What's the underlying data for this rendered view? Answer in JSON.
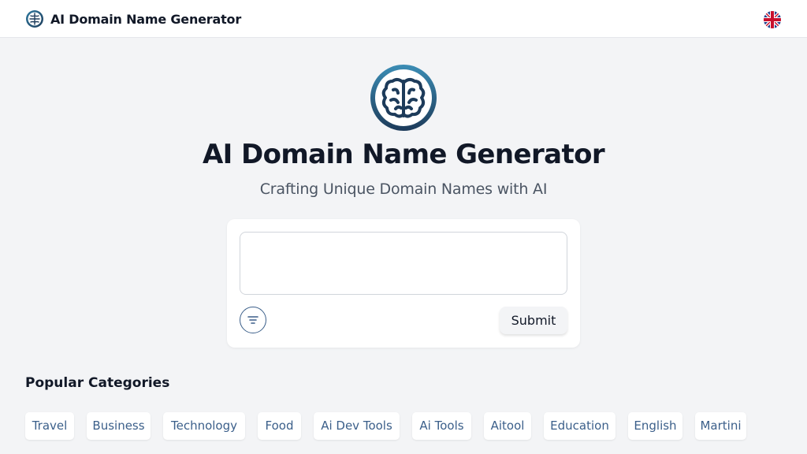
{
  "header": {
    "title": "AI Domain Name Generator",
    "logo_icon": "brain-globe-icon",
    "language_icon": "uk-flag-icon"
  },
  "hero": {
    "logo_icon": "brain-icon",
    "title": "AI Domain Name Generator",
    "subtitle": "Crafting Unique Domain Names with AI"
  },
  "form": {
    "input_value": "",
    "input_placeholder": "",
    "filter_icon": "filter-lines-icon",
    "submit_label": "Submit"
  },
  "categories": {
    "title": "Popular Categories",
    "items": [
      {
        "label": "Travel"
      },
      {
        "label": "Business"
      },
      {
        "label": "Technology"
      },
      {
        "label": "Food"
      },
      {
        "label": "Ai Dev Tools"
      },
      {
        "label": "Ai Tools"
      },
      {
        "label": "Aitool"
      },
      {
        "label": "Education"
      },
      {
        "label": "English"
      },
      {
        "label": "Martini"
      }
    ]
  },
  "colors": {
    "accent": "#3b5f8a",
    "background": "#f3f4f6",
    "card": "#ffffff",
    "text": "#111827"
  }
}
